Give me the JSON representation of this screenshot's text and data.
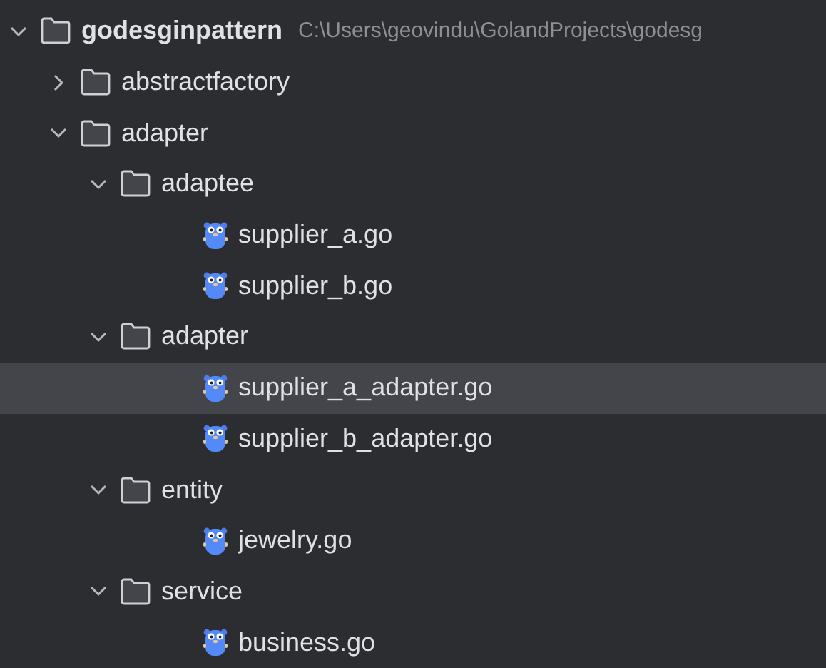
{
  "tree": [
    {
      "kind": "folder",
      "name": "godesginpattern",
      "path": "C:\\Users\\geovindu\\GolandProjects\\godesg",
      "expanded": true,
      "selected": false,
      "children": [
        {
          "kind": "folder",
          "name": "abstractfactory",
          "expanded": false,
          "selected": false
        },
        {
          "kind": "folder",
          "name": "adapter",
          "expanded": true,
          "selected": false,
          "children": [
            {
              "kind": "folder",
              "name": "adaptee",
              "expanded": true,
              "selected": false,
              "children": [
                {
                  "kind": "file",
                  "name": "supplier_a.go",
                  "selected": false
                },
                {
                  "kind": "file",
                  "name": "supplier_b.go",
                  "selected": false
                }
              ]
            },
            {
              "kind": "folder",
              "name": "adapter",
              "expanded": true,
              "selected": false,
              "children": [
                {
                  "kind": "file",
                  "name": "supplier_a_adapter.go",
                  "selected": true
                },
                {
                  "kind": "file",
                  "name": "supplier_b_adapter.go",
                  "selected": false
                }
              ]
            },
            {
              "kind": "folder",
              "name": "entity",
              "expanded": true,
              "selected": false,
              "children": [
                {
                  "kind": "file",
                  "name": "jewelry.go",
                  "selected": false
                }
              ]
            },
            {
              "kind": "folder",
              "name": "service",
              "expanded": true,
              "selected": false,
              "children": [
                {
                  "kind": "file",
                  "name": "business.go",
                  "selected": false
                }
              ]
            }
          ]
        }
      ]
    }
  ]
}
